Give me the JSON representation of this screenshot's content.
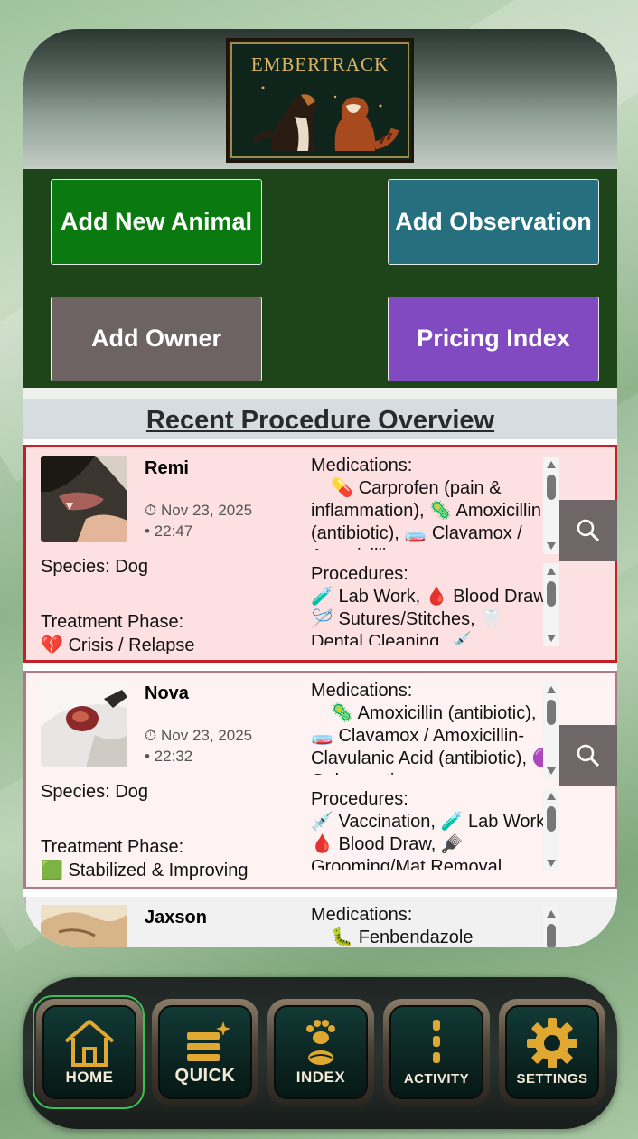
{
  "app": {
    "logo_text": "EMBERTRACK"
  },
  "actions": {
    "add_animal": "Add New Animal",
    "add_observation": "Add Observation",
    "add_owner": "Add Owner",
    "pricing_index": "Pricing Index"
  },
  "overview": {
    "title": "Recent Procedure Overview",
    "cards": [
      {
        "name": "Remi",
        "date": "⏱ Nov 23, 2025",
        "time": "• 22:47",
        "species": "Species: Dog",
        "phase_label": "Treatment Phase:",
        "phase": "💔 Crisis / Relapse",
        "medications_label": "Medications:",
        "medications": "    💊 Carprofen (pain & inflammation), 🦠 Amoxicillin (antibiotic), 🧫 Clavamox / Amoxicillin",
        "procedures_label": "Procedures:",
        "procedures": "🧪 Lab Work, 🩸 Blood Draw, 🪡 Sutures/Stitches, 🦷 Dental Cleaning, 💉"
      },
      {
        "name": "Nova",
        "date": "⏱ Nov 23, 2025",
        "time": "• 22:32",
        "species": "Species: Dog",
        "phase_label": "Treatment Phase:",
        "phase": "🟩 Stabilized & Improving",
        "medications_label": "Medications:",
        "medications": "    🦠 Amoxicillin (antibiotic), 🧫 Clavamox / Amoxicillin-Clavulanic Acid (antibiotic), 🟣 Gabapentin",
        "procedures_label": "Procedures:",
        "procedures": "💉 Vaccination, 🧪 Lab Work, 🩸 Blood Draw, 🪮 Grooming/Mat Removal,"
      },
      {
        "name": "Jaxson",
        "medications_label": "Medications:",
        "medications": "    🐛 Fenbendazole"
      }
    ]
  },
  "nav": {
    "home": "HOME",
    "quick": "QUICK",
    "index": "INDEX",
    "activity": "ACTIVITY",
    "settings": "SETTINGS"
  },
  "colors": {
    "add_animal": "#0a7a10",
    "add_observation": "#256f7f",
    "add_owner": "#6d6362",
    "pricing_index": "#814ac1",
    "panel_bg": "#1e4519",
    "nav_icon_gold": "#e0a830",
    "home_active_ring": "#3cc157"
  }
}
